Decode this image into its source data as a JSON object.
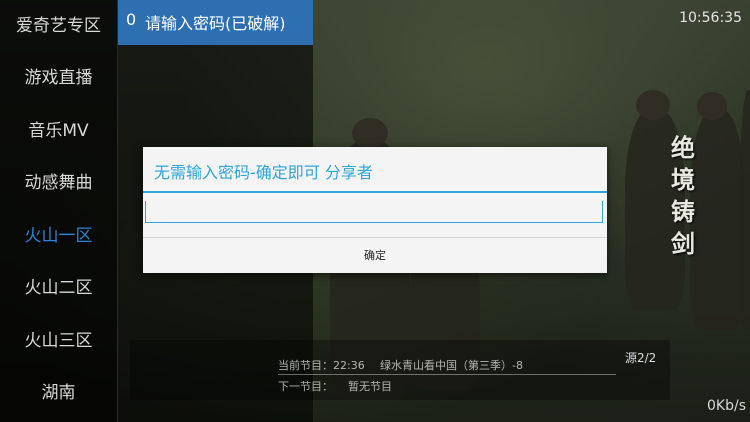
{
  "sidebar": {
    "items": [
      {
        "label": "爱奇艺专区",
        "active": false
      },
      {
        "label": "游戏直播",
        "active": false
      },
      {
        "label": "音乐MV",
        "active": false
      },
      {
        "label": "动感舞曲",
        "active": false
      },
      {
        "label": "火山一区",
        "active": true
      },
      {
        "label": "火山二区",
        "active": false
      },
      {
        "label": "火山三区",
        "active": false
      },
      {
        "label": "湖南",
        "active": false
      }
    ]
  },
  "channel": {
    "number": "0",
    "name": "请输入密码(已破解)"
  },
  "clock": "10:56:35",
  "film_title": "绝境铸剑",
  "epg": {
    "current_label": "当前节目：22:36",
    "current_title": "绿水青山看中国（第三季）-8",
    "next_label": "下一节目：",
    "next_title": "暂无节目"
  },
  "source": "源2/2",
  "net_speed": "0Kb/s",
  "dialog": {
    "title": "无需输入密码-确定即可 分享者",
    "input_value": "",
    "ok_label": "确定"
  },
  "colors": {
    "accent": "#2ea6d8",
    "selection": "#2d6fb1",
    "active_category": "#2f83d6"
  }
}
